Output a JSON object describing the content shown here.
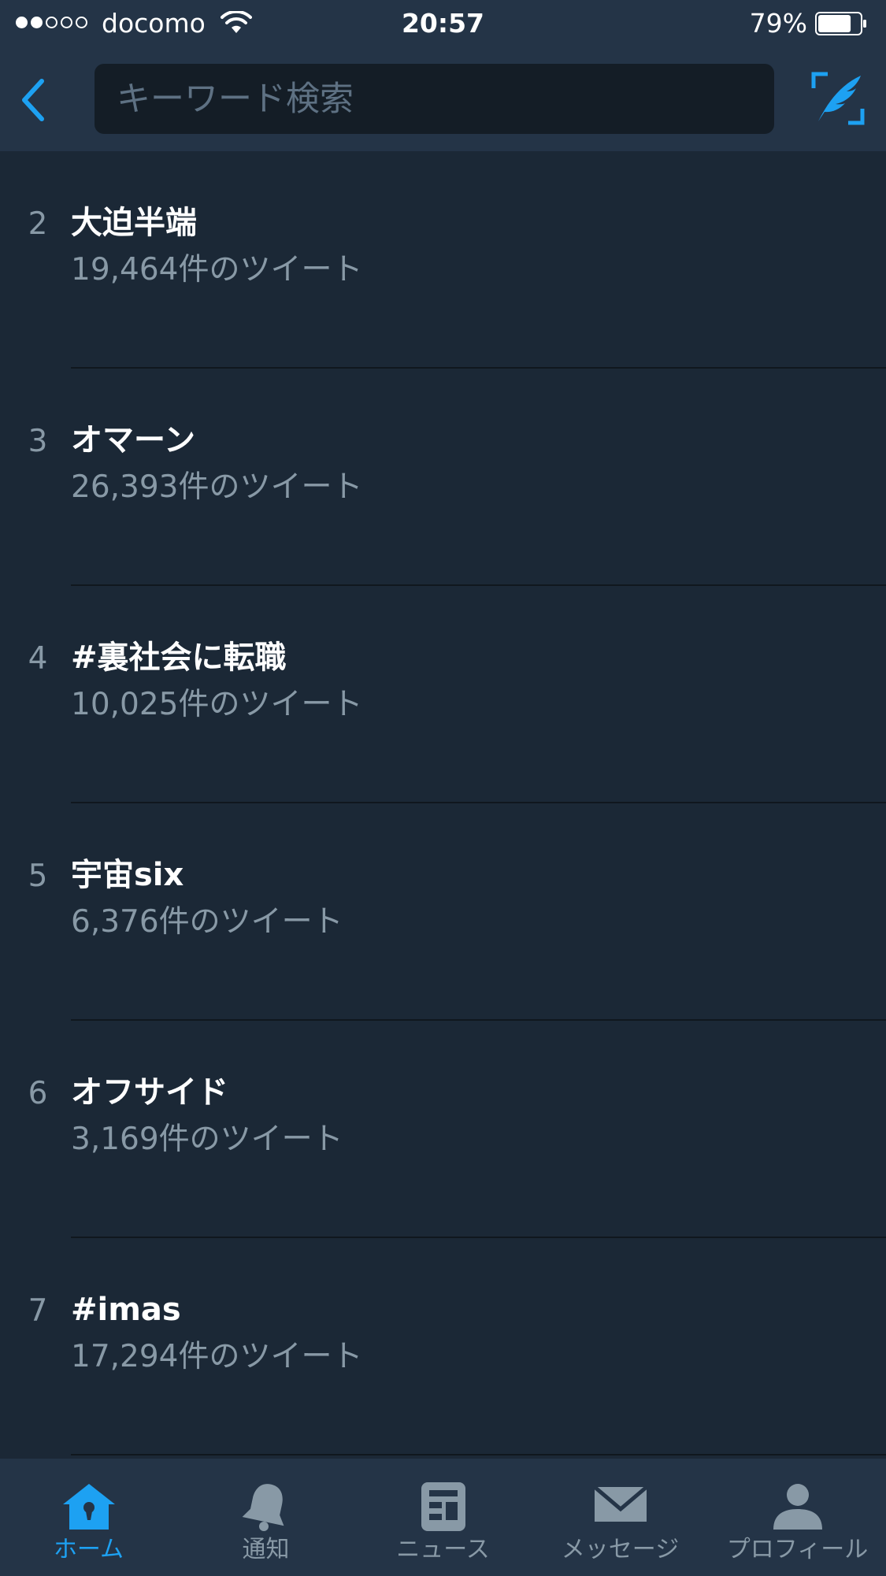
{
  "status_bar": {
    "signal_filled": 2,
    "signal_total": 5,
    "carrier": "docomo",
    "time": "20:57",
    "battery_percent": "79%",
    "battery_level": 0.79
  },
  "nav": {
    "back_icon": "chevron-left-icon",
    "search_placeholder": "キーワード検索",
    "search_value": "",
    "compose_icon": "compose-quill-icon"
  },
  "trends": [
    {
      "rank": "2",
      "name": "大迫半端",
      "count": "19,464件のツイート"
    },
    {
      "rank": "3",
      "name": "オマーン",
      "count": "26,393件のツイート"
    },
    {
      "rank": "4",
      "name": "#裏社会に転職",
      "count": "10,025件のツイート"
    },
    {
      "rank": "5",
      "name": "宇宙six",
      "count": "6,376件のツイート"
    },
    {
      "rank": "6",
      "name": "オフサイド",
      "count": "3,169件のツイート"
    },
    {
      "rank": "7",
      "name": "#imas",
      "count": "17,294件のツイート"
    }
  ],
  "tabs": [
    {
      "label": "ホーム",
      "icon": "home-icon",
      "active": true
    },
    {
      "label": "通知",
      "icon": "bell-icon",
      "active": false
    },
    {
      "label": "ニュース",
      "icon": "news-icon",
      "active": false
    },
    {
      "label": "メッセージ",
      "icon": "envelope-icon",
      "active": false
    },
    {
      "label": "プロフィール",
      "icon": "person-icon",
      "active": false
    }
  ],
  "colors": {
    "accent": "#1da1f2",
    "background": "#1b2836",
    "bar_background": "#243447",
    "secondary_text": "#8899a6"
  }
}
